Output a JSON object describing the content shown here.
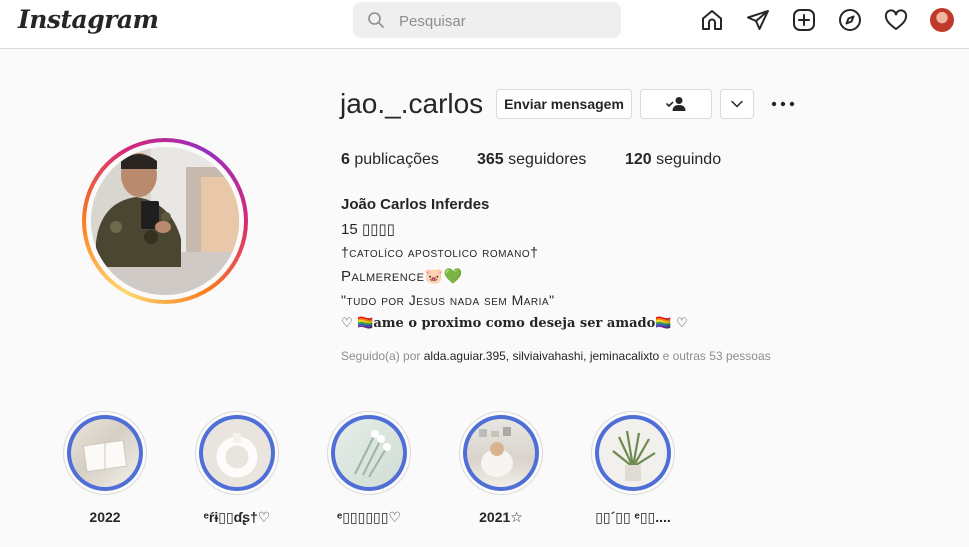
{
  "topbar": {
    "logo": "Instagram",
    "search_placeholder": "Pesquisar",
    "icons": [
      "home-icon",
      "direct-icon",
      "new-post-icon",
      "explore-icon",
      "activity-icon",
      "profile-avatar"
    ]
  },
  "profile": {
    "username": "jao._.carlos",
    "message_button": "Enviar mensagem",
    "stats": {
      "posts_count": "6",
      "posts_label": "publicações",
      "followers_count": "365",
      "followers_label": "seguidores",
      "following_count": "120",
      "following_label": "seguindo"
    },
    "full_name": "João Carlos Inferdes",
    "bio": [
      "15 ▯▯▯▯",
      "†catolíco apostolico romano†",
      "Palmerence🐷💚",
      "\"tudo por Jesus nada sem Maria\"",
      "♡ 🏳️‍🌈ame o proximo como deseja ser amado🏳️‍🌈 ♡"
    ],
    "followed_by": {
      "prefix": "Seguido(a) por",
      "users": "alda.aguiar.395, silviaivahashi, jeminacalixto",
      "suffix": "e outras 53 pessoas"
    }
  },
  "highlights": [
    {
      "label": "2022"
    },
    {
      "label": "ᵉŕɨ▯▯ɗʂ†♡"
    },
    {
      "label": "ᵉ▯▯▯▯▯▯♡"
    },
    {
      "label": "2021☆"
    },
    {
      "label": "▯▯´▯▯ ᵉ▯▯...."
    }
  ],
  "colors": {
    "accent_blue": "#4f6fd6",
    "text": "#262626",
    "muted": "#8e8e8e",
    "border": "#dbdbdb"
  }
}
